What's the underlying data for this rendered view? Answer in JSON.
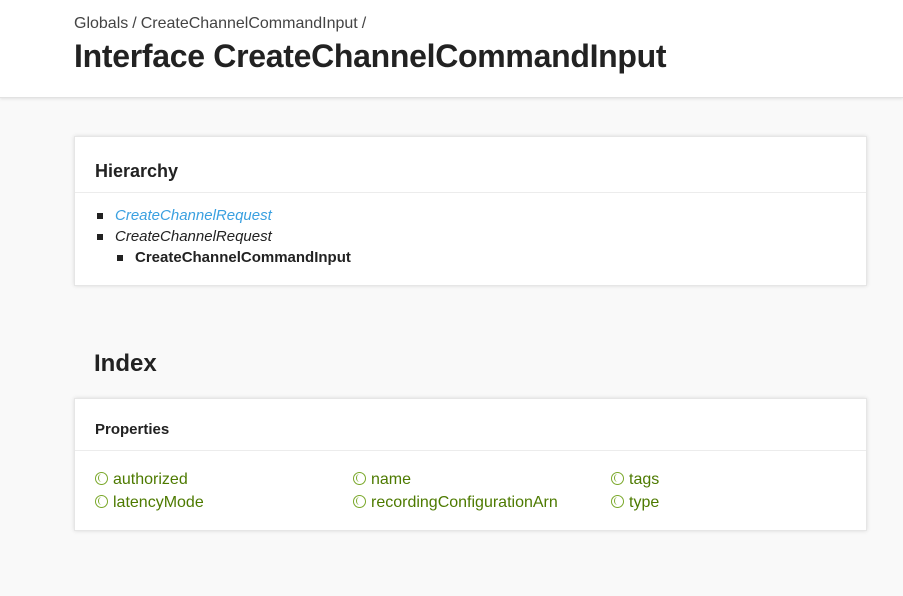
{
  "breadcrumb": {
    "items": [
      "Globals",
      "CreateChannelCommandInput"
    ],
    "separator": "/"
  },
  "page_title": "Interface CreateChannelCommandInput",
  "hierarchy": {
    "heading": "Hierarchy",
    "items": [
      {
        "label": "CreateChannelRequest",
        "style": "link"
      },
      {
        "label": "CreateChannelRequest",
        "style": "italic"
      },
      {
        "label": "CreateChannelCommandInput",
        "style": "current"
      }
    ]
  },
  "index": {
    "title": "Index",
    "properties_heading": "Properties",
    "properties": [
      "authorized",
      "latencyMode",
      "name",
      "recordingConfigurationArn",
      "tags",
      "type"
    ]
  },
  "colors": {
    "link_blue": "#3aa0e0",
    "property_green": "#4d7a00",
    "background": "#f9f9f9"
  },
  "icons": {
    "property": "property-ring-icon",
    "bullet": "square-bullet-icon"
  }
}
